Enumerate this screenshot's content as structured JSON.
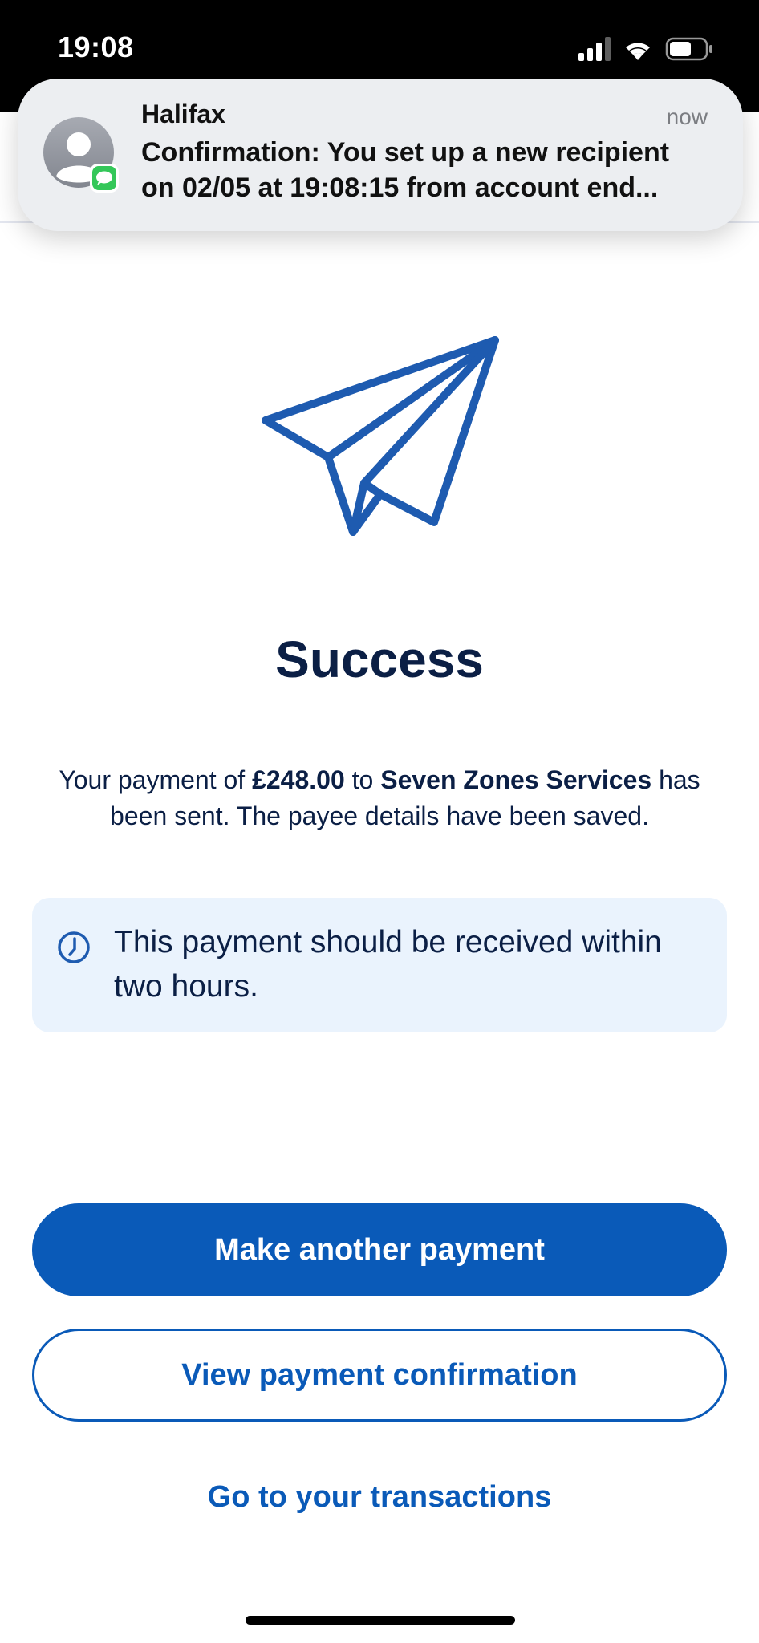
{
  "status_bar": {
    "time": "19:08",
    "icons": [
      "signal-icon",
      "wifi-icon",
      "battery-icon"
    ]
  },
  "notification": {
    "app_name": "Halifax",
    "time": "now",
    "body": "Confirmation: You set up a new recipient\non 02/05 at 19:08:15 from account end...",
    "icons": [
      "contact-avatar-icon",
      "messages-icon"
    ]
  },
  "main": {
    "hero_icon": "paper-plane-icon",
    "title": "Success",
    "message": {
      "prefix": "Your payment of ",
      "amount": "£248.00",
      "middle": " to ",
      "payee": "Seven Zones Services",
      "suffix": " has been sent. The payee details have been saved."
    },
    "info": {
      "icon": "clock-icon",
      "text": "This payment should be received within two hours."
    }
  },
  "actions": {
    "primary": "Make another payment",
    "secondary": "View payment confirmation",
    "link": "Go to your transactions"
  },
  "colors": {
    "brand_blue": "#0a5ab8",
    "navy_text": "#0b1f45",
    "info_background": "#eaf3fd"
  }
}
